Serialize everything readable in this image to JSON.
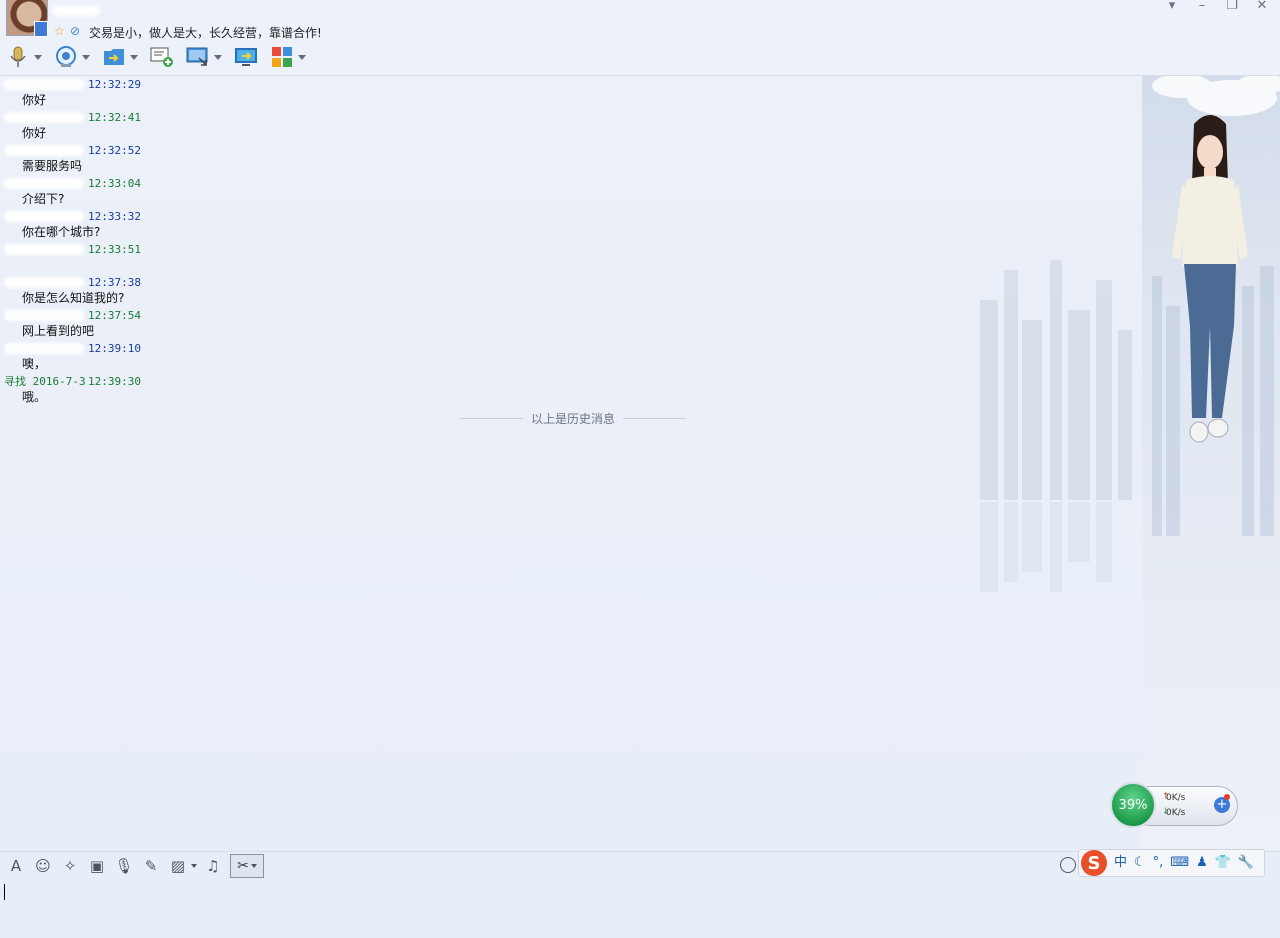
{
  "header": {
    "signature": "交易是小，做人是大，长久经营，靠谱合作!",
    "window_controls": [
      {
        "icon": "dropdown-arrow-icon",
        "glyph": "▾"
      },
      {
        "icon": "minimize-icon",
        "glyph": "–"
      },
      {
        "icon": "restore-icon",
        "glyph": "❐"
      },
      {
        "icon": "close-icon",
        "glyph": "✕"
      }
    ]
  },
  "toolbar": {
    "items": [
      {
        "icon": "microphone-icon",
        "has_dropdown": true
      },
      {
        "icon": "webcam-icon",
        "has_dropdown": true
      },
      {
        "icon": "file-transfer-icon",
        "has_dropdown": true
      },
      {
        "icon": "create-discussion-icon",
        "has_dropdown": false
      },
      {
        "icon": "remote-desktop-icon",
        "has_dropdown": true
      },
      {
        "icon": "share-screen-icon",
        "has_dropdown": false
      },
      {
        "icon": "apps-icon",
        "has_dropdown": true
      }
    ]
  },
  "messages": [
    {
      "sender": "",
      "time": "12:32:29",
      "color": "blue",
      "text": "你好"
    },
    {
      "sender": "",
      "time": "12:32:41",
      "color": "green",
      "text": "你好"
    },
    {
      "sender": "",
      "time": "12:32:52",
      "color": "blue",
      "text": "需要服务吗"
    },
    {
      "sender": "",
      "time": "12:33:04",
      "color": "green",
      "text": "介绍下?"
    },
    {
      "sender": "",
      "time": "12:33:32",
      "color": "blue",
      "text": "你在哪个城市?"
    },
    {
      "sender": "",
      "time": "12:33:51",
      "color": "green",
      "text": ""
    },
    {
      "sender": "",
      "time": "12:37:38",
      "color": "blue",
      "text": "你是怎么知道我的?"
    },
    {
      "sender": "",
      "time": "12:37:54",
      "color": "green",
      "text": "网上看到的吧"
    },
    {
      "sender": "",
      "time": "12:39:10",
      "color": "blue",
      "text": "噢，"
    },
    {
      "sender": "寻找 2016-7-3",
      "time": "12:39:30",
      "color": "green",
      "text": "哦。"
    }
  ],
  "history_divider": "以上是历史消息",
  "input_toolbar": [
    {
      "icon": "font-icon",
      "glyph": "A"
    },
    {
      "icon": "emoji-icon",
      "glyph": "☺"
    },
    {
      "icon": "magic-wand-icon",
      "glyph": "✧"
    },
    {
      "icon": "gif-icon",
      "glyph": "▣"
    },
    {
      "icon": "voice-message-icon",
      "glyph": "🎙"
    },
    {
      "icon": "edit-icon",
      "glyph": "✎"
    },
    {
      "icon": "image-icon",
      "glyph": "▨"
    },
    {
      "icon": "music-icon",
      "glyph": "♫"
    }
  ],
  "network_widget": {
    "percent": "39%",
    "upload": "0K/s",
    "download": "0K/s"
  },
  "ime": {
    "logo": "S",
    "items": [
      {
        "icon": "chinese-mode-icon",
        "glyph": "中"
      },
      {
        "icon": "moon-icon",
        "glyph": "☾"
      },
      {
        "icon": "punctuation-icon",
        "glyph": "°,"
      },
      {
        "icon": "keyboard-icon",
        "glyph": "⌨"
      },
      {
        "icon": "user-icon",
        "glyph": "♟"
      },
      {
        "icon": "skin-icon",
        "glyph": "👕"
      },
      {
        "icon": "settings-wrench-icon",
        "glyph": "🔧"
      }
    ]
  },
  "colors": {
    "accent_blue": "#1a3c9a",
    "accent_green": "#1a7a36",
    "background": "#e9eef7"
  }
}
